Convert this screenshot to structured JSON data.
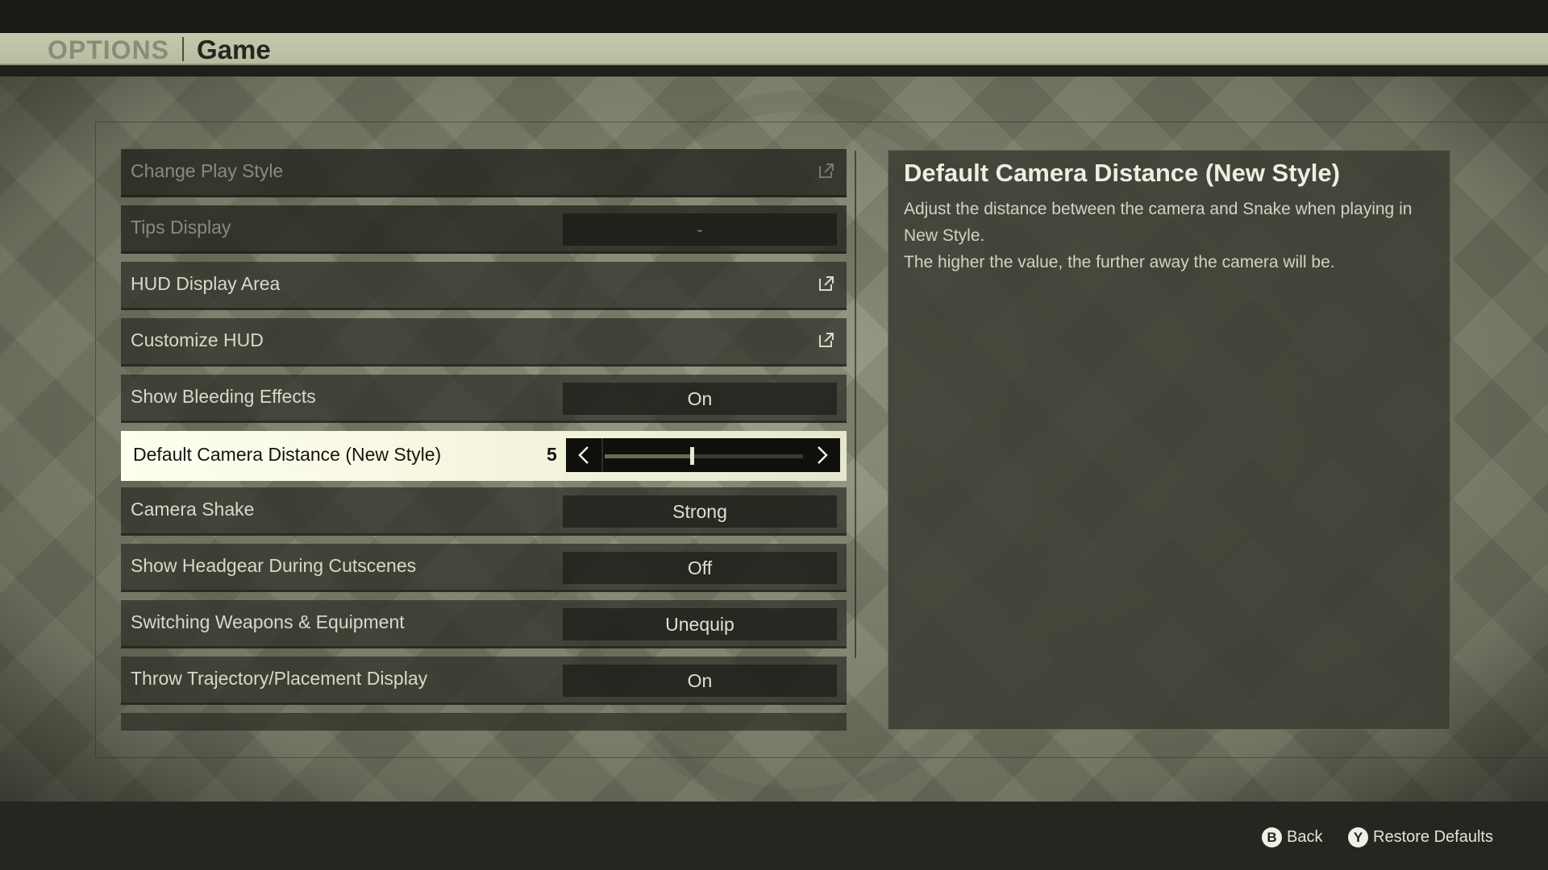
{
  "header": {
    "section": "OPTIONS",
    "current": "Game"
  },
  "settings": [
    {
      "label": "Change Play Style",
      "type": "link",
      "state": "disabled"
    },
    {
      "label": "Tips Display",
      "type": "value",
      "value": "-",
      "state": "disabled"
    },
    {
      "label": "HUD Display Area",
      "type": "link"
    },
    {
      "label": "Customize HUD",
      "type": "link"
    },
    {
      "label": "Show Bleeding Effects",
      "type": "value",
      "value": "On"
    },
    {
      "label": "Default Camera Distance (New Style)",
      "type": "slider",
      "value": "5",
      "slider_fraction": 0.44,
      "selected": true
    },
    {
      "label": "Camera Shake",
      "type": "value",
      "value": "Strong"
    },
    {
      "label": "Show Headgear During Cutscenes",
      "type": "value",
      "value": "Off"
    },
    {
      "label": "Switching Weapons & Equipment",
      "type": "value",
      "value": "Unequip"
    },
    {
      "label": "Throw Trajectory/Placement Display",
      "type": "value",
      "value": "On"
    }
  ],
  "description": {
    "title": "Default Camera Distance (New Style)",
    "line1": "Adjust the distance between the camera and Snake when playing in New Style.",
    "line2": "The higher the value, the further away the camera will be."
  },
  "footer": {
    "back": {
      "glyph": "B",
      "label": "Back"
    },
    "restore": {
      "glyph": "Y",
      "label": "Restore Defaults"
    }
  },
  "icons": {
    "external_link": "external-link-icon",
    "arrow_left": "chevron-left-icon",
    "arrow_right": "chevron-right-icon"
  }
}
